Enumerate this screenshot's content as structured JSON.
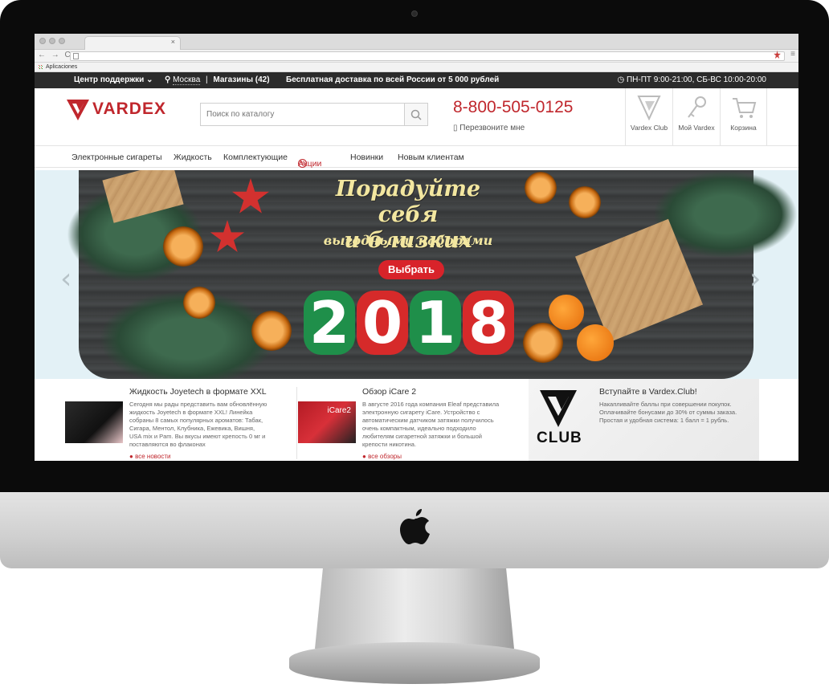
{
  "browser": {
    "tab_title": "",
    "bookmarks_label": "Aplicaciones"
  },
  "topbar": {
    "support": "Центр поддержки",
    "city": "Москва",
    "separator": "|",
    "stores": "Магазины",
    "stores_count": "(42)",
    "shipping": "Бесплатная доставка по всей России от 5 000 рублей",
    "hours": "ПН-ПТ 9:00-21:00, СБ-ВС 10:00-20:00"
  },
  "header": {
    "logo_text": "VARDEX",
    "search_placeholder": "Поиск по каталогу",
    "phone": "8-800-505-0125",
    "callback": "Перезвоните мне",
    "buttons": [
      {
        "label": "Vardex Club"
      },
      {
        "label": "Мой Vardex"
      },
      {
        "label": "Корзина"
      }
    ]
  },
  "nav": {
    "items": [
      "Электронные сигареты",
      "Жидкость",
      "Комплектующие",
      "Акции",
      "Новинки",
      "Новым клиентам"
    ]
  },
  "banner": {
    "title_line1": "Порадуйте себя",
    "title_line2": "и близких",
    "subtitle": "выгодными наборами",
    "button": "Выбрать",
    "year": [
      "2",
      "0",
      "1",
      "8"
    ]
  },
  "news": [
    {
      "title": "Жидкость Joyetech в формате XXL",
      "text": "Сегодня мы рады представить вам обновлённую жидкость Joyetech в формате XXL! Линейка собраны 8 самых популярных ароматов: Табак, Сигара, Ментол, Клубника, Ежевика, Вишня, USA mix и Pam. Вы вкусы имеют крепость 0 мг и поставляются во флаконах",
      "link": "все новости"
    },
    {
      "title": "Обзор iCare 2",
      "thumb_label": "iCare2",
      "text": "В августе 2016 года компания Eleaf представила электронную сигарету iCare. Устройство с автоматическим датчиком затяжки получилось очень компактным, идеально подходило любителям сигаретной затяжки и большой крепости никотина.",
      "link": "все обзоры"
    }
  ],
  "club": {
    "title": "Вступайте в Vardex.Club!",
    "text": "Накапливайте баллы при совершении покупок. Оплачивайте бонусами до 30% от суммы заказа. Простая и удобная система: 1 балл = 1 рубль.",
    "logo_word": "CLUB"
  },
  "colors": {
    "brand_red": "#c0272d",
    "topbar_bg": "#2b2b2b",
    "banner_bg": "#e3f1f6"
  }
}
